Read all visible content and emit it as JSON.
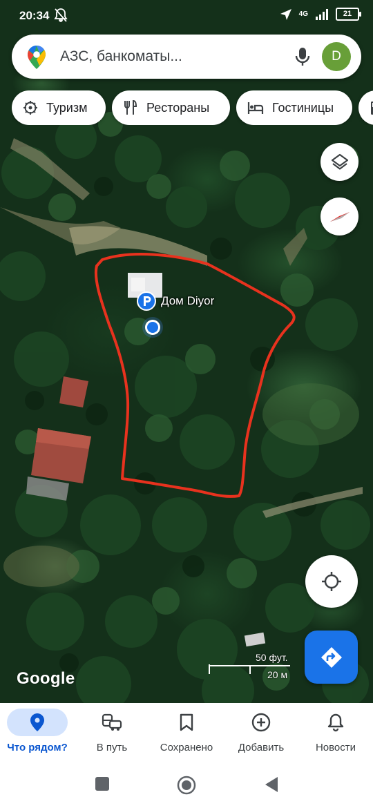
{
  "status_bar": {
    "time": "20:34",
    "network": "4G",
    "battery": "21"
  },
  "search": {
    "placeholder": "АЗС, банкоматы...",
    "avatar_letter": "D"
  },
  "chips": [
    {
      "label": "Туризм",
      "icon": "landmark-icon"
    },
    {
      "label": "Рестораны",
      "icon": "restaurant-icon"
    },
    {
      "label": "Гостиницы",
      "icon": "hotel-icon"
    },
    {
      "label": "",
      "icon": "gas-station-icon"
    }
  ],
  "map": {
    "place_name": "Дом Diyor",
    "attribution": "Google",
    "scale_feet": "50 фут.",
    "scale_meters": "20 м"
  },
  "bottom_nav": {
    "items": [
      {
        "label": "Что рядом?",
        "icon": "location-pin-icon",
        "active": true
      },
      {
        "label": "В путь",
        "icon": "commute-icon",
        "active": false
      },
      {
        "label": "Сохранено",
        "icon": "bookmark-icon",
        "active": false
      },
      {
        "label": "Добавить",
        "icon": "add-circle-icon",
        "active": false
      },
      {
        "label": "Новости",
        "icon": "bell-icon",
        "active": false
      }
    ]
  },
  "colors": {
    "accent_blue": "#1a73e8",
    "active_tab_bg": "#d3e3fd",
    "highlight_outline": "#e8321e",
    "avatar_bg": "#689f38"
  }
}
